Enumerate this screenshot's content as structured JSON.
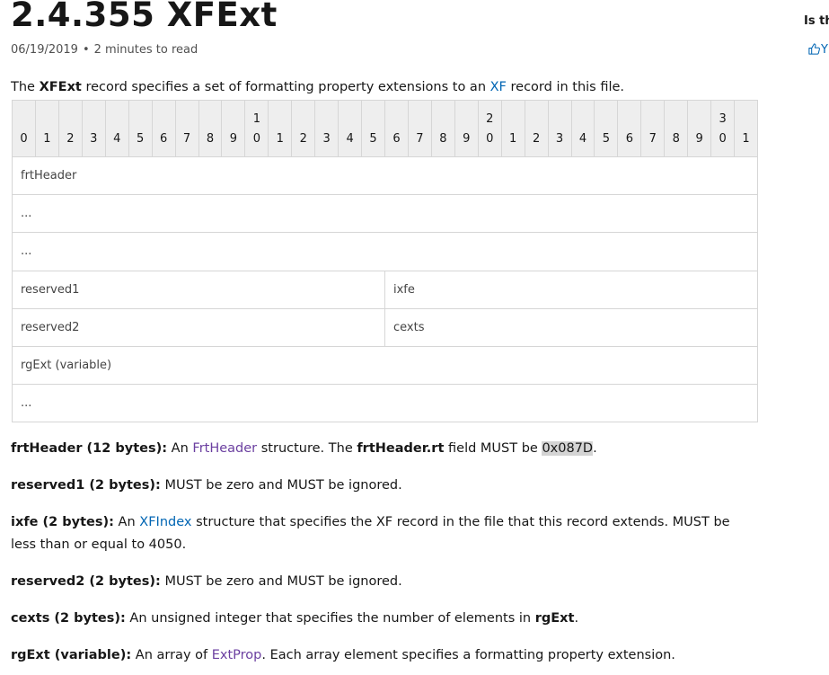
{
  "page": {
    "title": "2.4.355 XFExt",
    "date": "06/19/2019",
    "separator": "•",
    "read_time": "2 minutes to read"
  },
  "side": {
    "question": "Is th",
    "like_label": "Y"
  },
  "intro": {
    "p1": "The ",
    "record": "XFExt",
    "p2": " record specifies a set of formatting property extensions to an ",
    "link_xf": "XF",
    "p3": " record in this file."
  },
  "bit_header": {
    "tens": [
      "",
      "",
      "",
      "",
      "",
      "",
      "",
      "",
      "",
      "",
      "1",
      "",
      "",
      "",
      "",
      "",
      "",
      "",
      "",
      "",
      "2",
      "",
      "",
      "",
      "",
      "",
      "",
      "",
      "",
      "",
      "3",
      ""
    ],
    "ones": [
      "0",
      "1",
      "2",
      "3",
      "4",
      "5",
      "6",
      "7",
      "8",
      "9",
      "0",
      "1",
      "2",
      "3",
      "4",
      "5",
      "6",
      "7",
      "8",
      "9",
      "0",
      "1",
      "2",
      "3",
      "4",
      "5",
      "6",
      "7",
      "8",
      "9",
      "0",
      "1"
    ]
  },
  "rows": [
    {
      "cells": [
        {
          "label": "frtHeader",
          "span": 32
        }
      ]
    },
    {
      "cells": [
        {
          "label": "...",
          "span": 32
        }
      ]
    },
    {
      "cells": [
        {
          "label": "...",
          "span": 32
        }
      ]
    },
    {
      "cells": [
        {
          "label": "reserved1",
          "span": 16
        },
        {
          "label": "ixfe",
          "span": 16
        }
      ]
    },
    {
      "cells": [
        {
          "label": "reserved2",
          "span": 16
        },
        {
          "label": "cexts",
          "span": 16
        }
      ]
    },
    {
      "cells": [
        {
          "label": "rgExt (variable)",
          "span": 32
        }
      ]
    },
    {
      "cells": [
        {
          "label": "...",
          "span": 32
        }
      ]
    }
  ],
  "definitions": {
    "frtHeader": {
      "term": "frtHeader (12 bytes)",
      "colon": ":",
      "t1": " An ",
      "link": "FrtHeader",
      "t2": " structure. The ",
      "bold2": "frtHeader.rt",
      "t3": " field MUST be ",
      "code": "0x087D",
      "t4": "."
    },
    "reserved1": {
      "term": "reserved1 (2 bytes)",
      "colon": ":",
      "t1": " MUST be zero and MUST be ignored."
    },
    "ixfe": {
      "term": "ixfe (2 bytes)",
      "colon": ":",
      "t1": " An ",
      "link": "XFIndex",
      "t2": " structure that specifies the XF record in the file that this record extends. MUST be less than or equal to 4050."
    },
    "reserved2": {
      "term": "reserved2 (2 bytes)",
      "colon": ":",
      "t1": " MUST be zero and MUST be ignored."
    },
    "cexts": {
      "term": "cexts (2 bytes)",
      "colon": ":",
      "t1": " An unsigned integer that specifies the number of elements in ",
      "bold2": "rgExt",
      "t2": "."
    },
    "rgExt": {
      "term": "rgExt (variable)",
      "colon": ":",
      "t1": " An array of ",
      "link": "ExtProp",
      "t2": ".  Each array element specifies a formatting property extension."
    }
  }
}
